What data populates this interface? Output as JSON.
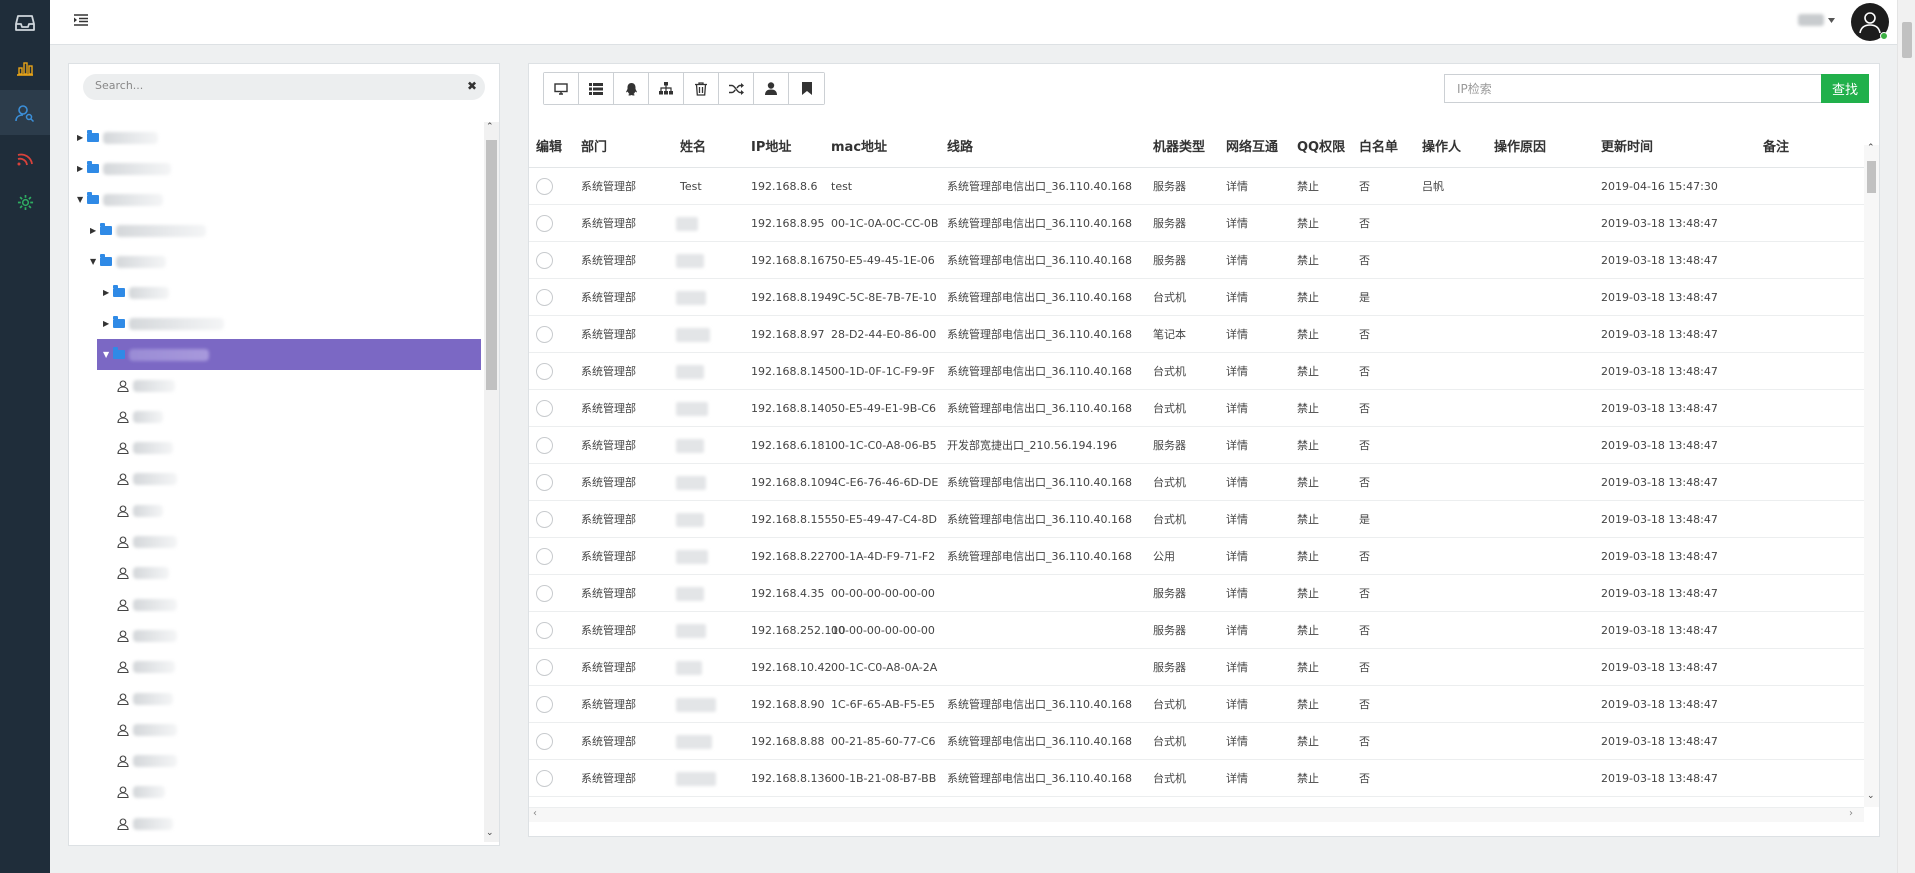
{
  "search": {
    "placeholder": "Search..."
  },
  "ip_search": {
    "placeholder": "IP检索",
    "button_label": "查找"
  },
  "columns": [
    "编辑",
    "部门",
    "姓名",
    "IP地址",
    "mac地址",
    "线路",
    "机器类型",
    "网络互通",
    "QQ权限",
    "白名单",
    "操作人",
    "操作原因",
    "更新时间",
    "备注"
  ],
  "rows": [
    {
      "dept": "系统管理部",
      "name": "Test",
      "ip": "192.168.8.6",
      "mac": "test",
      "line": "系统管理部电信出口_36.110.40.168",
      "type": "服务器",
      "net": "详情",
      "qq": "禁止",
      "white": "否",
      "operator": "吕帆",
      "reason": "",
      "time": "2019-04-16 15:47:30",
      "note": ""
    },
    {
      "dept": "系统管理部",
      "name": "",
      "ip": "192.168.8.95",
      "mac": "00-1C-0A-0C-CC-0B",
      "line": "系统管理部电信出口_36.110.40.168",
      "type": "服务器",
      "net": "详情",
      "qq": "禁止",
      "white": "否",
      "operator": "",
      "reason": "",
      "time": "2019-03-18 13:48:47",
      "note": ""
    },
    {
      "dept": "系统管理部",
      "name": "",
      "ip": "192.168.8.167",
      "mac": "50-E5-49-45-1E-06",
      "line": "系统管理部电信出口_36.110.40.168",
      "type": "服务器",
      "net": "详情",
      "qq": "禁止",
      "white": "否",
      "operator": "",
      "reason": "",
      "time": "2019-03-18 13:48:47",
      "note": ""
    },
    {
      "dept": "系统管理部",
      "name": "",
      "ip": "192.168.8.194",
      "mac": "9C-5C-8E-7B-7E-10",
      "line": "系统管理部电信出口_36.110.40.168",
      "type": "台式机",
      "net": "详情",
      "qq": "禁止",
      "white": "是",
      "operator": "",
      "reason": "",
      "time": "2019-03-18 13:48:47",
      "note": ""
    },
    {
      "dept": "系统管理部",
      "name": "",
      "ip": "192.168.8.97",
      "mac": "28-D2-44-E0-86-00",
      "line": "系统管理部电信出口_36.110.40.168",
      "type": "笔记本",
      "net": "详情",
      "qq": "禁止",
      "white": "否",
      "operator": "",
      "reason": "",
      "time": "2019-03-18 13:48:47",
      "note": ""
    },
    {
      "dept": "系统管理部",
      "name": "",
      "ip": "192.168.8.145",
      "mac": "00-1D-0F-1C-F9-9F",
      "line": "系统管理部电信出口_36.110.40.168",
      "type": "台式机",
      "net": "详情",
      "qq": "禁止",
      "white": "否",
      "operator": "",
      "reason": "",
      "time": "2019-03-18 13:48:47",
      "note": ""
    },
    {
      "dept": "系统管理部",
      "name": "",
      "ip": "192.168.8.140",
      "mac": "50-E5-49-E1-9B-C6",
      "line": "系统管理部电信出口_36.110.40.168",
      "type": "台式机",
      "net": "详情",
      "qq": "禁止",
      "white": "否",
      "operator": "",
      "reason": "",
      "time": "2019-03-18 13:48:47",
      "note": ""
    },
    {
      "dept": "系统管理部",
      "name": "",
      "ip": "192.168.6.181",
      "mac": "00-1C-C0-A8-06-B5",
      "line": "开发部宽捷出口_210.56.194.196",
      "type": "服务器",
      "net": "详情",
      "qq": "禁止",
      "white": "否",
      "operator": "",
      "reason": "",
      "time": "2019-03-18 13:48:47",
      "note": ""
    },
    {
      "dept": "系统管理部",
      "name": "",
      "ip": "192.168.8.109",
      "mac": "4C-E6-76-46-6D-DE",
      "line": "系统管理部电信出口_36.110.40.168",
      "type": "台式机",
      "net": "详情",
      "qq": "禁止",
      "white": "否",
      "operator": "",
      "reason": "",
      "time": "2019-03-18 13:48:47",
      "note": ""
    },
    {
      "dept": "系统管理部",
      "name": "",
      "ip": "192.168.8.155",
      "mac": "50-E5-49-47-C4-8D",
      "line": "系统管理部电信出口_36.110.40.168",
      "type": "台式机",
      "net": "详情",
      "qq": "禁止",
      "white": "是",
      "operator": "",
      "reason": "",
      "time": "2019-03-18 13:48:47",
      "note": ""
    },
    {
      "dept": "系统管理部",
      "name": "",
      "ip": "192.168.8.227",
      "mac": "00-1A-4D-F9-71-F2",
      "line": "系统管理部电信出口_36.110.40.168",
      "type": "公用",
      "net": "详情",
      "qq": "禁止",
      "white": "否",
      "operator": "",
      "reason": "",
      "time": "2019-03-18 13:48:47",
      "note": ""
    },
    {
      "dept": "系统管理部",
      "name": "",
      "ip": "192.168.4.35",
      "mac": "00-00-00-00-00-00",
      "line": "",
      "type": "服务器",
      "net": "详情",
      "qq": "禁止",
      "white": "否",
      "operator": "",
      "reason": "",
      "time": "2019-03-18 13:48:47",
      "note": ""
    },
    {
      "dept": "系统管理部",
      "name": "",
      "ip": "192.168.252.110",
      "mac": "00-00-00-00-00-00",
      "line": "",
      "type": "服务器",
      "net": "详情",
      "qq": "禁止",
      "white": "否",
      "operator": "",
      "reason": "",
      "time": "2019-03-18 13:48:47",
      "note": ""
    },
    {
      "dept": "系统管理部",
      "name": "",
      "ip": "192.168.10.42",
      "mac": "00-1C-C0-A8-0A-2A",
      "line": "",
      "type": "服务器",
      "net": "详情",
      "qq": "禁止",
      "white": "否",
      "operator": "",
      "reason": "",
      "time": "2019-03-18 13:48:47",
      "note": ""
    },
    {
      "dept": "系统管理部",
      "name": "",
      "ip": "192.168.8.90",
      "mac": "1C-6F-65-AB-F5-E5",
      "line": "系统管理部电信出口_36.110.40.168",
      "type": "台式机",
      "net": "详情",
      "qq": "禁止",
      "white": "否",
      "operator": "",
      "reason": "",
      "time": "2019-03-18 13:48:47",
      "note": ""
    },
    {
      "dept": "系统管理部",
      "name": "",
      "ip": "192.168.8.88",
      "mac": "00-21-85-60-77-C6",
      "line": "系统管理部电信出口_36.110.40.168",
      "type": "台式机",
      "net": "详情",
      "qq": "禁止",
      "white": "否",
      "operator": "",
      "reason": "",
      "time": "2019-03-18 13:48:47",
      "note": ""
    },
    {
      "dept": "系统管理部",
      "name": "",
      "ip": "192.168.8.136",
      "mac": "00-1B-21-08-B7-BB",
      "line": "系统管理部电信出口_36.110.40.168",
      "type": "台式机",
      "net": "详情",
      "qq": "禁止",
      "white": "否",
      "operator": "",
      "reason": "",
      "time": "2019-03-18 13:48:47",
      "note": ""
    }
  ],
  "tree": {
    "folders": [
      {
        "depth": 0,
        "expanded": false,
        "icon": "folder-icon"
      },
      {
        "depth": 0,
        "expanded": false,
        "icon": "folder-icon"
      },
      {
        "depth": 0,
        "expanded": true,
        "icon": "folder-icon"
      },
      {
        "depth": 1,
        "expanded": false,
        "icon": "folder-icon"
      },
      {
        "depth": 1,
        "expanded": true,
        "icon": "folder-icon"
      },
      {
        "depth": 2,
        "expanded": false,
        "icon": "folder-icon"
      },
      {
        "depth": 2,
        "expanded": false,
        "icon": "folder-icon"
      },
      {
        "depth": 2,
        "expanded": true,
        "icon": "folder-icon",
        "selected": true
      }
    ],
    "person_count": 15
  },
  "toolbar_icons": [
    "monitor-icon",
    "list-icon",
    "qq-icon",
    "sitemap-icon",
    "trash-icon",
    "shuffle-icon",
    "user-icon",
    "bookmark-icon"
  ],
  "rail_icons": [
    "inbox-icon",
    "bar-chart-icon",
    "user-search-icon",
    "rss-icon",
    "gear-icon"
  ],
  "colors": {
    "rail": "#1f2d3a",
    "selected": "#7b68c4",
    "folder": "#2f8ae6",
    "accent_green": "#21b04b",
    "rail_chart": "#e8a317",
    "rail_user": "#3b8fd9",
    "rail_rss": "#d9423b",
    "rail_gear": "#2fae62"
  }
}
